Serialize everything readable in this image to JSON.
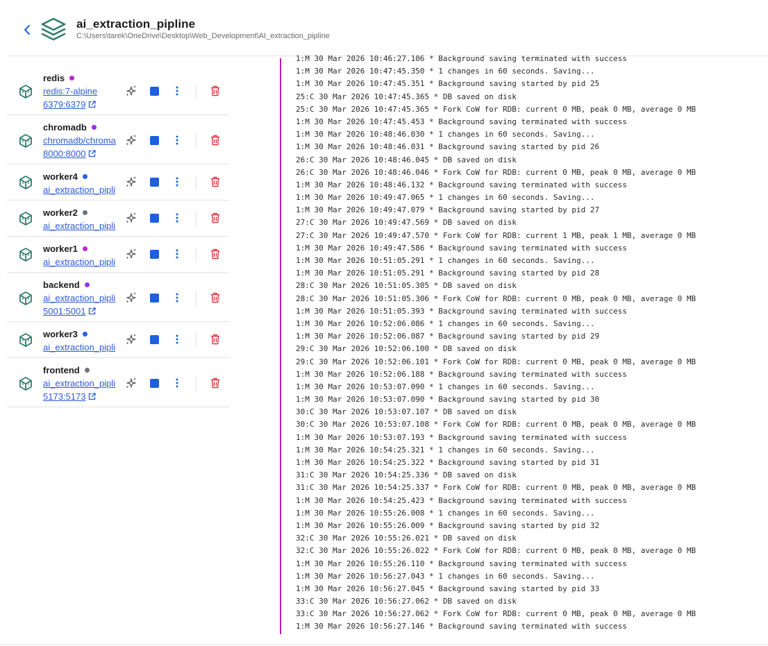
{
  "project": {
    "title": "ai_extraction_pipline",
    "path": "C:\\Users\\tarek\\OneDrive\\Desktop\\Web_Development\\AI_extraction_pipline"
  },
  "colors": {
    "accent": "#1e5fe0",
    "cube": "#2f7d6b",
    "delete": "#d9363e",
    "log_border": "#b91ba8"
  },
  "containers": [
    {
      "name": "redis",
      "status_color": "#c026d3",
      "image": "redis:7-alpine",
      "port": "6379:6379"
    },
    {
      "name": "chromadb",
      "status_color": "#9333ea",
      "image": "chromadb/chroma",
      "port": "8000:8000"
    },
    {
      "name": "worker4",
      "status_color": "#2563eb",
      "image": "ai_extraction_pipli",
      "port": ""
    },
    {
      "name": "worker2",
      "status_color": "#6b7280",
      "image": "ai_extraction_pipli",
      "port": ""
    },
    {
      "name": "worker1",
      "status_color": "#c026d3",
      "image": "ai_extraction_pipli",
      "port": ""
    },
    {
      "name": "backend",
      "status_color": "#9333ea",
      "image": "ai_extraction_pipli",
      "port": "5001:5001"
    },
    {
      "name": "worker3",
      "status_color": "#2563eb",
      "image": "ai_extraction_pipli",
      "port": ""
    },
    {
      "name": "frontend",
      "status_color": "#6b7280",
      "image": "ai_extraction_pipli",
      "port": "5173:5173"
    }
  ],
  "logs": [
    "1:M 30 Mar 2026 10:46:27.106 * Background saving terminated with success",
    "1:M 30 Mar 2026 10:47:45.350 * 1 changes in 60 seconds. Saving...",
    "1:M 30 Mar 2026 10:47:45.351 * Background saving started by pid 25",
    "25:C 30 Mar 2026 10:47:45.365 * DB saved on disk",
    "25:C 30 Mar 2026 10:47:45.365 * Fork CoW for RDB: current 0 MB, peak 0 MB, average 0 MB",
    "1:M 30 Mar 2026 10:47:45.453 * Background saving terminated with success",
    "1:M 30 Mar 2026 10:48:46.030 * 1 changes in 60 seconds. Saving...",
    "1:M 30 Mar 2026 10:48:46.031 * Background saving started by pid 26",
    "26:C 30 Mar 2026 10:48:46.045 * DB saved on disk",
    "26:C 30 Mar 2026 10:48:46.046 * Fork CoW for RDB: current 0 MB, peak 0 MB, average 0 MB",
    "1:M 30 Mar 2026 10:48:46.132 * Background saving terminated with success",
    "1:M 30 Mar 2026 10:49:47.065 * 1 changes in 60 seconds. Saving...",
    "1:M 30 Mar 2026 10:49:47.079 * Background saving started by pid 27",
    "27:C 30 Mar 2026 10:49:47.569 * DB saved on disk",
    "27:C 30 Mar 2026 10:49:47.570 * Fork CoW for RDB: current 1 MB, peak 1 MB, average 0 MB",
    "1:M 30 Mar 2026 10:49:47.586 * Background saving terminated with success",
    "1:M 30 Mar 2026 10:51:05.291 * 1 changes in 60 seconds. Saving...",
    "1:M 30 Mar 2026 10:51:05.291 * Background saving started by pid 28",
    "28:C 30 Mar 2026 10:51:05.305 * DB saved on disk",
    "28:C 30 Mar 2026 10:51:05.306 * Fork CoW for RDB: current 0 MB, peak 0 MB, average 0 MB",
    "1:M 30 Mar 2026 10:51:05.393 * Background saving terminated with success",
    "1:M 30 Mar 2026 10:52:06.086 * 1 changes in 60 seconds. Saving...",
    "1:M 30 Mar 2026 10:52:06.087 * Background saving started by pid 29",
    "29:C 30 Mar 2026 10:52:06.100 * DB saved on disk",
    "29:C 30 Mar 2026 10:52:06.101 * Fork CoW for RDB: current 0 MB, peak 0 MB, average 0 MB",
    "1:M 30 Mar 2026 10:52:06.188 * Background saving terminated with success",
    "1:M 30 Mar 2026 10:53:07.090 * 1 changes in 60 seconds. Saving...",
    "1:M 30 Mar 2026 10:53:07.090 * Background saving started by pid 30",
    "30:C 30 Mar 2026 10:53:07.107 * DB saved on disk",
    "30:C 30 Mar 2026 10:53:07.108 * Fork CoW for RDB: current 0 MB, peak 0 MB, average 0 MB",
    "1:M 30 Mar 2026 10:53:07.193 * Background saving terminated with success",
    "1:M 30 Mar 2026 10:54:25.321 * 1 changes in 60 seconds. Saving...",
    "1:M 30 Mar 2026 10:54:25.322 * Background saving started by pid 31",
    "31:C 30 Mar 2026 10:54:25.336 * DB saved on disk",
    "31:C 30 Mar 2026 10:54:25.337 * Fork CoW for RDB: current 0 MB, peak 0 MB, average 0 MB",
    "1:M 30 Mar 2026 10:54:25.423 * Background saving terminated with success",
    "1:M 30 Mar 2026 10:55:26.008 * 1 changes in 60 seconds. Saving...",
    "1:M 30 Mar 2026 10:55:26.009 * Background saving started by pid 32",
    "32:C 30 Mar 2026 10:55:26.021 * DB saved on disk",
    "32:C 30 Mar 2026 10:55:26.022 * Fork CoW for RDB: current 0 MB, peak 0 MB, average 0 MB",
    "1:M 30 Mar 2026 10:55:26.110 * Background saving terminated with success",
    "1:M 30 Mar 2026 10:56:27.043 * 1 changes in 60 seconds. Saving...",
    "1:M 30 Mar 2026 10:56:27.045 * Background saving started by pid 33",
    "33:C 30 Mar 2026 10:56:27.062 * DB saved on disk",
    "33:C 30 Mar 2026 10:56:27.062 * Fork CoW for RDB: current 0 MB, peak 0 MB, average 0 MB",
    "1:M 30 Mar 2026 10:56:27.146 * Background saving terminated with success"
  ]
}
